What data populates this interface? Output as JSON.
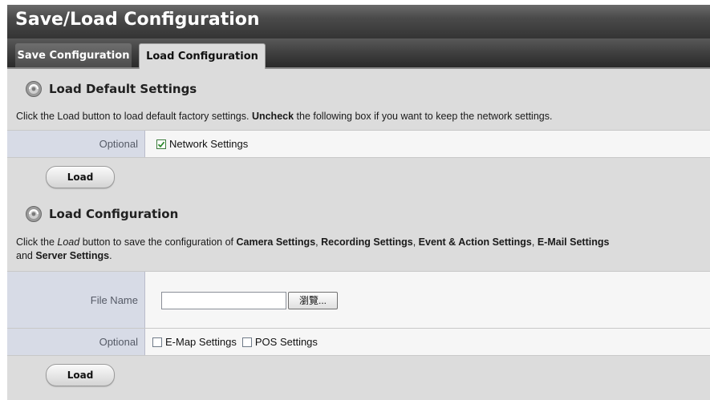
{
  "app": {
    "title": "Save/Load Configuration"
  },
  "tabs": [
    {
      "label": "Save Configuration",
      "active": false
    },
    {
      "label": "Load Configuration",
      "active": true
    }
  ],
  "default_section": {
    "title": "Load Default Settings",
    "desc_parts": [
      "Click the Load button to load default factory settings. ",
      "Uncheck",
      " the following box if you want to keep the network settings."
    ],
    "optional_label": "Optional",
    "network_checkbox": {
      "label": "Network Settings",
      "checked": true
    },
    "load_label": "Load"
  },
  "config_section": {
    "title": "Load Configuration",
    "desc_parts": [
      "Click the ",
      "Load",
      " button to save the configuration of ",
      "Camera Settings",
      ", ",
      "Recording Settings",
      ", ",
      "Event & Action Settings",
      ", ",
      "E-Mail Settings",
      "and ",
      "Server Settings",
      "."
    ],
    "file_label": "File Name",
    "file_value": "",
    "browse_label": "瀏覽...",
    "optional_label": "Optional",
    "emap_checkbox": {
      "label": "E-Map Settings",
      "checked": false
    },
    "pos_checkbox": {
      "label": "POS Settings",
      "checked": false
    },
    "load_label": "Load"
  },
  "colors": {
    "title_bar": "#3c3c3c",
    "panel_bg": "#dcdcdc",
    "label_cell_bg": "#d7dbe6",
    "row_bg": "#f6f6f6"
  }
}
